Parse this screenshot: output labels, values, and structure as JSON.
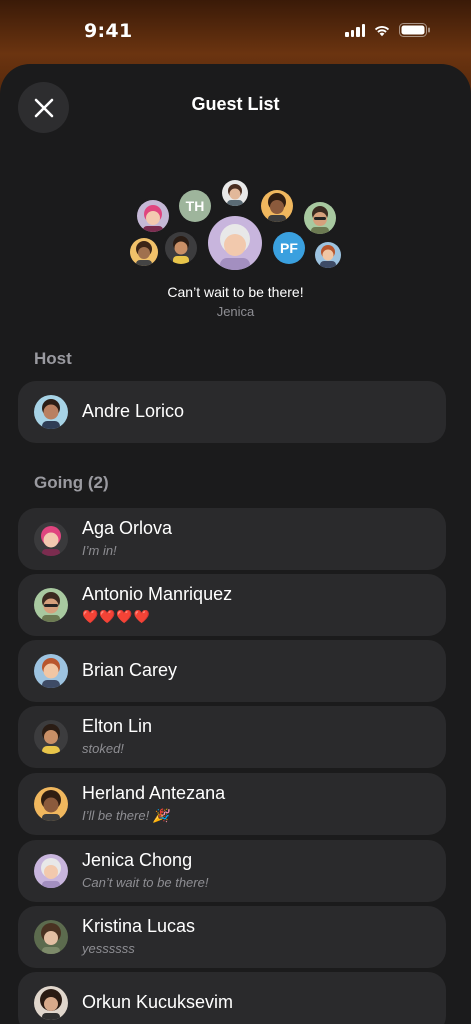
{
  "status": {
    "time": "9:41"
  },
  "sheet": {
    "title": "Guest List"
  },
  "featured": {
    "quote": "Can’t wait to be there!",
    "author": "Jenica"
  },
  "cluster_initials": [
    "TH",
    "PF"
  ],
  "sections": {
    "host": "Host",
    "going": "Going (2)"
  },
  "host": {
    "name": "Andre Lorico"
  },
  "guests": [
    {
      "name": "Aga Orlova",
      "note": "I’m in!"
    },
    {
      "name": "Antonio Manriquez",
      "note": "❤️❤️❤️❤️"
    },
    {
      "name": "Brian Carey",
      "note": ""
    },
    {
      "name": "Elton Lin",
      "note": "stoked!"
    },
    {
      "name": "Herland Antezana",
      "note": "I’ll be there! 🎉"
    },
    {
      "name": "Jenica Chong",
      "note": "Can’t wait to be there!"
    },
    {
      "name": "Kristina Lucas",
      "note": "yessssss"
    },
    {
      "name": "Orkun Kucuksevim",
      "note": ""
    }
  ],
  "colors": {
    "sheet_bg": "#1b1b1c",
    "row_bg": "#2a2a2c",
    "secondary_text": "#8e8e93",
    "heart": "#ff2d3d"
  }
}
